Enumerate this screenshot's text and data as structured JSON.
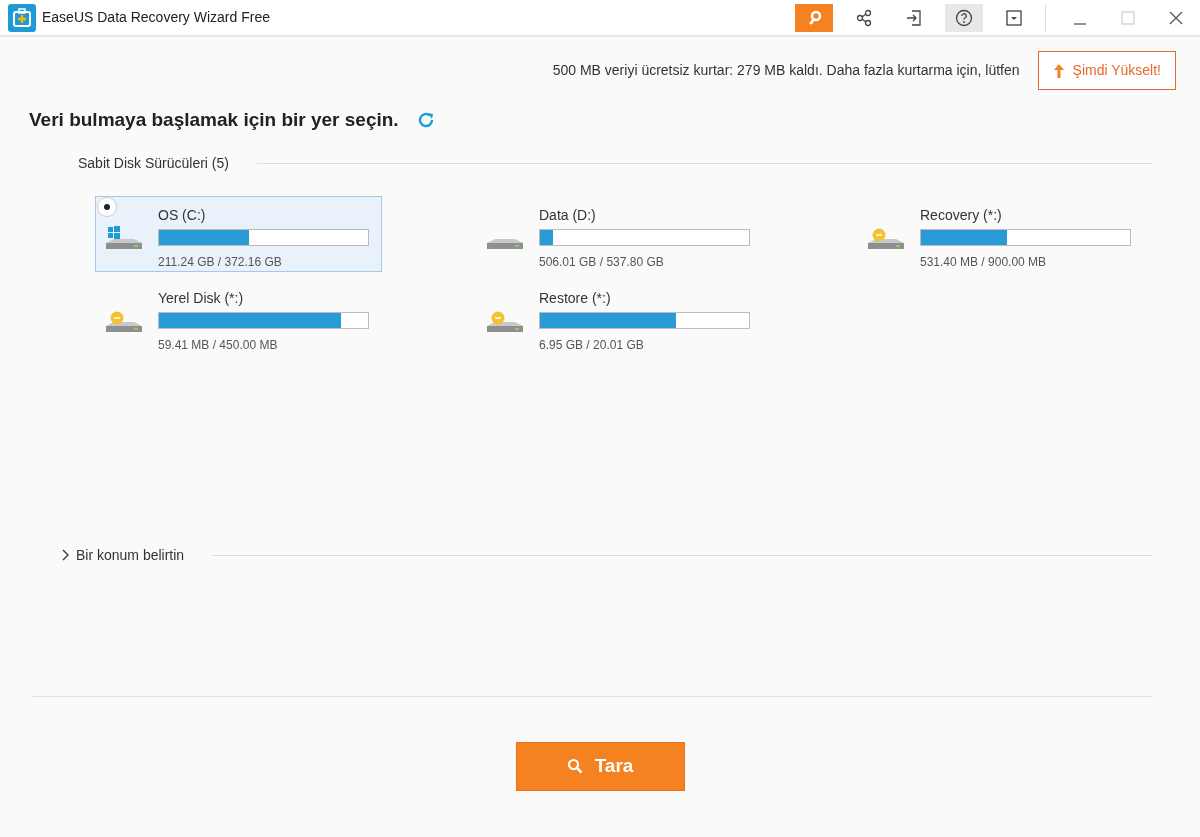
{
  "window": {
    "title": "EaseUS Data Recovery Wizard Free"
  },
  "quota": {
    "text": "500 MB veriyi ücretsiz kurtar: 279 MB kaldı. Daha fazla kurtarma için, lütfen",
    "upgrade_button": "Şimdi Yükselt!"
  },
  "heading": "Veri bulmaya başlamak için bir yer seçin.",
  "drives_section": {
    "title": "Sabit Disk Sürücüleri (5)",
    "drives": [
      {
        "name": "OS (C:)",
        "kind": "system",
        "level": 0.43,
        "size": "211.24 GB / 372.16 GB",
        "selected": true
      },
      {
        "name": "Data (D:)",
        "kind": "plain",
        "level": 0.06,
        "size": "506.01 GB / 537.80 GB",
        "selected": false
      },
      {
        "name": "Recovery (*:)",
        "kind": "locked",
        "level": 0.41,
        "size": "531.40 MB / 900.00 MB",
        "selected": false
      },
      {
        "name": "Yerel Disk (*:)",
        "kind": "locked",
        "level": 0.87,
        "size": "59.41 MB / 450.00 MB",
        "selected": false
      },
      {
        "name": "Restore (*:)",
        "kind": "locked",
        "level": 0.65,
        "size": "6.95 GB / 20.01 GB",
        "selected": false
      }
    ]
  },
  "location_section": {
    "title": "Bir konum belirtin",
    "expanded": false
  },
  "scan_button": "Tara"
}
